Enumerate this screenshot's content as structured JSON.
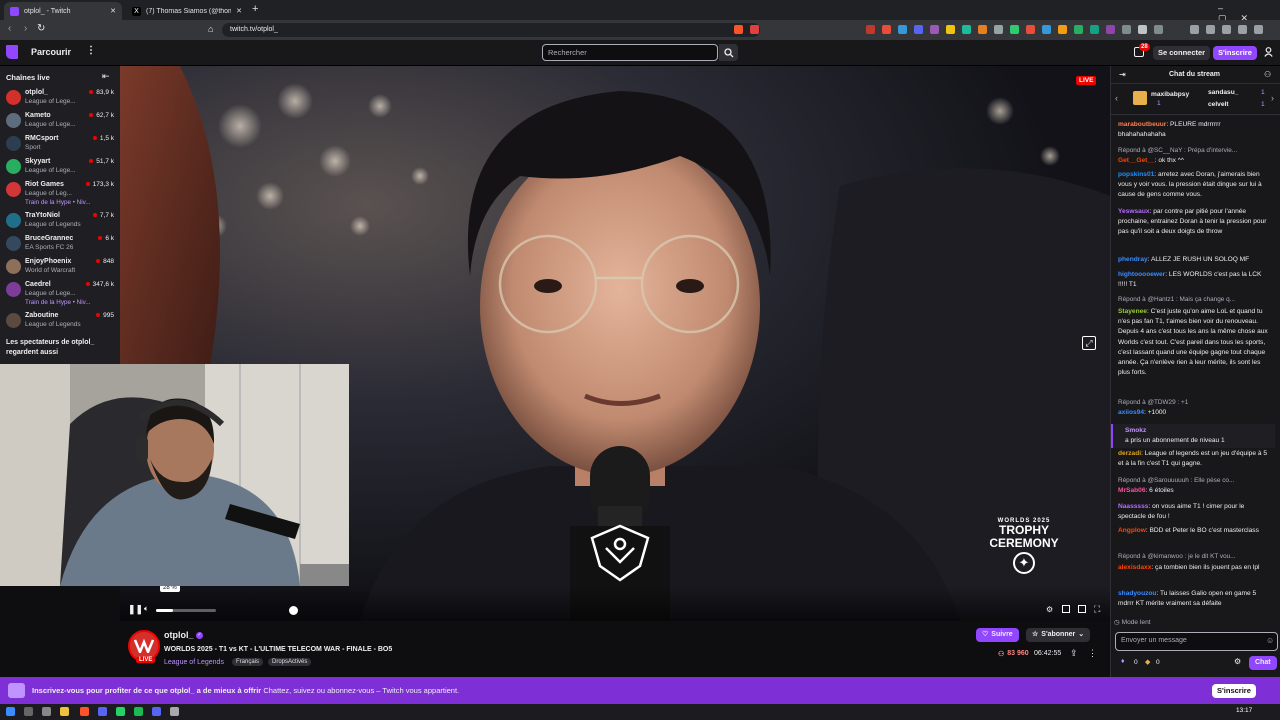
{
  "browser": {
    "tabs": [
      {
        "title": "otplol_ - Twitch"
      },
      {
        "title": "(7) Thomas Siamos (@thomassiamos"
      }
    ],
    "url": "twitch.tv/otplol_"
  },
  "topnav": {
    "browse": "Parcourir",
    "search_placeholder": "Rechercher",
    "notif_count": "28",
    "login": "Se connecter",
    "signup": "S'inscrire"
  },
  "sidebar": {
    "title": "Chaînes live",
    "channels": [
      {
        "name": "otplol_",
        "game": "League of Lege...",
        "viewers": "83,9 k",
        "color": "#d4302b"
      },
      {
        "name": "Kameto",
        "game": "League of Lege...",
        "viewers": "62,7 k",
        "color": "#5d6d7e"
      },
      {
        "name": "RMCsport",
        "game": "Sport",
        "viewers": "1,5 k",
        "color": "#2c3e50"
      },
      {
        "name": "Skyyart",
        "game": "League of Lege...",
        "viewers": "51,7 k",
        "color": "#27ae60"
      },
      {
        "name": "Riot Games",
        "game": "League of Leg...",
        "viewers": "173,3 k",
        "color": "#d13639",
        "hype": "Train de la Hype • Niv..."
      },
      {
        "name": "TraYtoNiol",
        "game": "League of Legends",
        "viewers": "7,7 k",
        "color": "#1f6f8b"
      },
      {
        "name": "BruceGrannec",
        "game": "EA Sports FC 26",
        "viewers": "6 k",
        "color": "#34495e"
      },
      {
        "name": "EnjoyPhoenix",
        "game": "World of Warcraft",
        "viewers": "848",
        "color": "#8e6f5a"
      },
      {
        "name": "Caedrel",
        "game": "League of Lege...",
        "viewers": "347,6 k",
        "color": "#7d3c98",
        "hype": "Train de la Hype • Niv..."
      },
      {
        "name": "Zaboutine",
        "game": "League of Legends",
        "viewers": "995",
        "color": "#5b4a3f"
      }
    ],
    "also_watch": "Les spectateurs de otplol_ regardent aussi"
  },
  "video": {
    "live_badge": "LIVE",
    "volume_tooltip": "28 %",
    "volume": 0.28,
    "overlay_small": "WORLDS 2025",
    "overlay_title": "TROPHY CEREMONY"
  },
  "stream": {
    "channel": "otplol_",
    "title": "WORLDS 2025 - T1 vs KT - L'ULTIME TELECOM WAR - FINALE - BO5",
    "category": "League of Legends",
    "tags": [
      "Français",
      "DropsActivés"
    ],
    "live": "LIVE",
    "follow": "Suivre",
    "subscribe": "S'abonner",
    "viewers": "83 960",
    "uptime": "06:42:55"
  },
  "chat": {
    "title": "Chat du stream",
    "gifters": [
      {
        "name": "maxibabpsy",
        "count": "1"
      },
      {
        "name": "sandasu_",
        "count": "1"
      },
      {
        "name": "celvelt",
        "count": "1"
      }
    ],
    "messages": [
      {
        "user": "maraboutbeuur",
        "color": "#ff7f50",
        "text": ": PLEURE mdrrrrrr bhahahahahaha"
      },
      {
        "reply": "Répond à @SC__NaY : Prépa d'intervie..."
      },
      {
        "user": "Get__Get__",
        "color": "#ff4500",
        "text": ": ok thx ^^"
      },
      {
        "user": "popskins01",
        "color": "#1e90ff",
        "text": ": arretez avec Doran, j'aimerais bien vous y voir vous. la pression était dingue sur lui à cause de gens comme vous."
      },
      {
        "user": "Yeswsaux",
        "color": "#b56cff",
        "text": ": par contre par pitié pour l'année prochaine, entrainez Doran à tenir la pression pour pas qu'il soit a deux doigts de throw"
      },
      {
        "user": "phendray",
        "color": "#3a8cff",
        "text": ": ALLEZ JE RUSH UN SOLOQ MF"
      },
      {
        "user": "hightooooewer",
        "color": "#3a8cff",
        "text": ": LES WORLDS c'est pas la LCK !!!!! T1"
      },
      {
        "reply": "Répond à @Hantz1 : Mais ça change q..."
      },
      {
        "user": "Stayenee",
        "color": "#9acd32",
        "text": ": C'est juste qu'on aime LoL et quand tu n'es pas fan T1, t'aimes bien voir du renouveau. Depuis 4 ans c'est tous les ans la même chose aux Worlds c'est tout. C'est pareil dans tous les sports, c'est lassant quand une équipe gagne tout chaque année. Ça n'enlève rien à leur mérite, ils sont les plus forts."
      },
      {
        "reply": "Répond à @TDW29 : +1"
      },
      {
        "user": "axiios94",
        "color": "#3a8cff",
        "text": ": +1000"
      },
      {
        "sub_user": "Smokz",
        "sub_text": "a pris un abonnement de niveau 1"
      },
      {
        "user": "derzadi",
        "color": "#daa520",
        "text": ": League of legends est un jeu d'équipe à 5 et à la fin c'est T1 qui gagne."
      },
      {
        "reply": "Répond à @Sarouuuuuh : Elle pèse co..."
      },
      {
        "user": "MrSab06",
        "color": "#ff4fa0",
        "text": ": 6 étoiles"
      },
      {
        "user": "Naasssss",
        "color": "#b56cff",
        "text": ": on vous aime T1 ! cimer pour le spectacle de fou !"
      },
      {
        "user": "Angplow",
        "color": "#ff4500",
        "text": ": BDD et Peter le BO c'est masterclass"
      },
      {
        "reply": "Répond à @kimanwoo : je le dit KT vou..."
      },
      {
        "user": "alexisdaxx",
        "color": "#ff4500",
        "text": ": ça tombien bien ils jouent pas en lpl"
      },
      {
        "user": "shadyouzou",
        "color": "#3a8cff",
        "text": ": Tu laisses Galio open en game 5 mdrrr KT mérite vraiment sa défaite"
      }
    ],
    "slow_mode": "Mode lent",
    "input_placeholder": "Envoyer un message",
    "points": "0",
    "bits": "0",
    "chat_button": "Chat"
  },
  "banner": {
    "text_bold": "Inscrivez-vous pour profiter de ce que otplol_ a de mieux à offrir",
    "text": "Chattez, suivez ou abonnez-vous – Twitch vous appartient.",
    "button": "S'inscrire"
  },
  "taskbar": {
    "time": "13:17"
  }
}
